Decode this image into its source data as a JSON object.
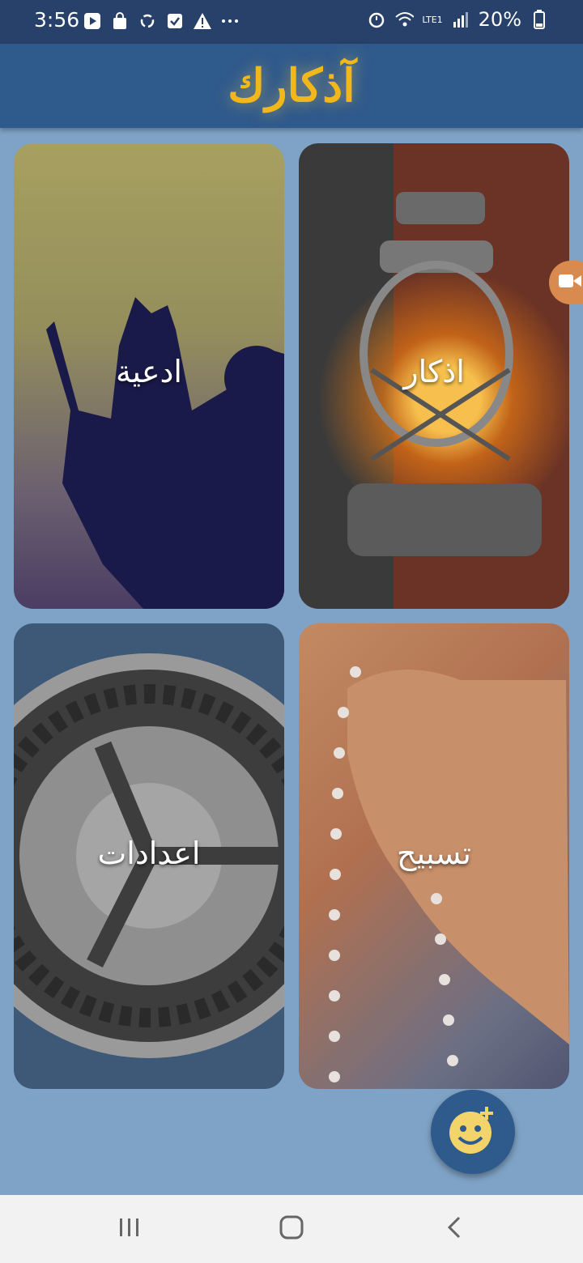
{
  "status_bar": {
    "time": "3:56",
    "battery": "20%",
    "network": "LTE1",
    "icons_left": [
      "play-icon",
      "bag-icon",
      "sync-icon",
      "check-icon",
      "warning-icon",
      "more-icon"
    ],
    "icons_right": [
      "alarm-icon",
      "wifi-icon",
      "signal-icon",
      "battery-icon"
    ]
  },
  "app_bar": {
    "title": "آذكارك"
  },
  "cards": {
    "adhkar": {
      "label": "اذكار"
    },
    "adeiya": {
      "label": "ادعية"
    },
    "tasbih": {
      "label": "تسبيح"
    },
    "settings": {
      "label": "اعدادات"
    }
  },
  "fab": {
    "icon": "emoji-add-icon"
  },
  "edge_button": {
    "icon": "video-icon"
  },
  "nav_bar": {
    "buttons": [
      "recents-icon",
      "home-icon",
      "back-icon"
    ]
  },
  "colors": {
    "status_bar": "#27416a",
    "app_bar": "#2f5a8c",
    "background": "#7fa3c6",
    "title": "#f2b81b"
  }
}
